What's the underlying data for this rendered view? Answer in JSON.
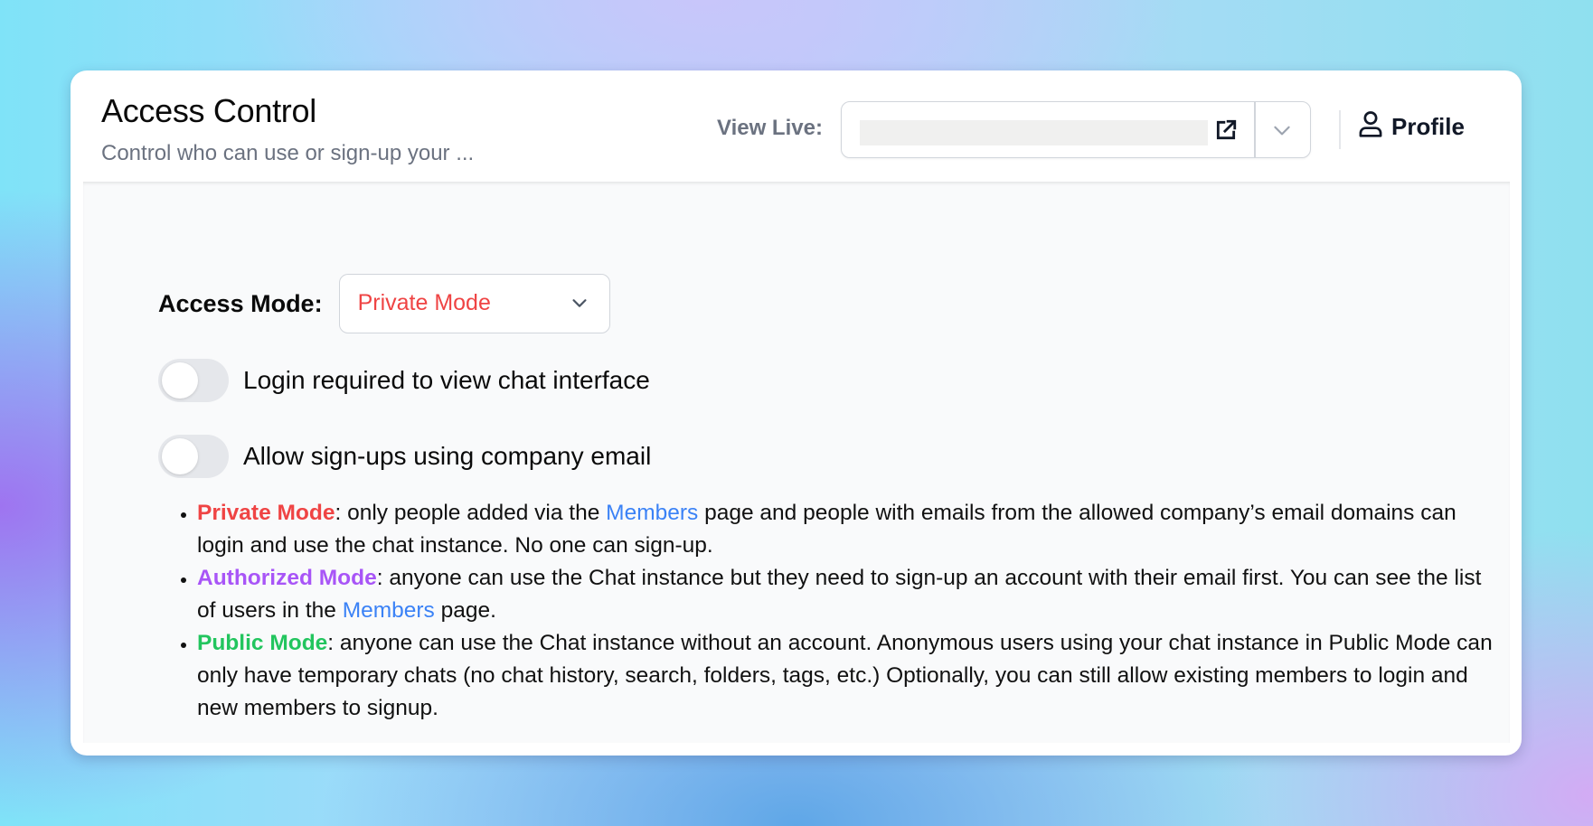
{
  "header": {
    "title": "Access Control",
    "subtitle": "Control who can use or sign-up your ...",
    "view_live_label": "View Live:",
    "view_live_url": "",
    "profile_label": "Profile"
  },
  "icons": {
    "external_link": "external-link-icon",
    "chevron_down": "chevron-down-icon",
    "user": "user-icon"
  },
  "access_mode": {
    "label": "Access Mode:",
    "selected": "Private Mode",
    "selected_color": "#ef4444"
  },
  "toggles": [
    {
      "label": "Login required to view chat interface",
      "on": false
    },
    {
      "label": "Allow sign-ups using company email",
      "on": false
    }
  ],
  "modes_info": [
    {
      "name": "Private Mode",
      "color": "#ef4444",
      "text_before_link": ": only people added via the ",
      "link": "Members",
      "text_after_link": " page and people with emails from the allowed company’s email domains can login and use the chat instance. No one can sign-up."
    },
    {
      "name": "Authorized Mode",
      "color": "#a855f7",
      "text_before_link": ": anyone can use the Chat instance but they need to sign-up an account with their email first. You can see the list of users in the ",
      "link": "Members",
      "text_after_link": " page."
    },
    {
      "name": "Public Mode",
      "color": "#22c55e",
      "text": ": anyone can use the Chat instance without an account. Anonymous users using your chat instance in Public Mode can only have temporary chats (no chat history, search, folders, tags, etc.) Optionally, you can still allow existing members to login and new members to signup."
    }
  ],
  "colors": {
    "link": "#3b82f6",
    "muted_text": "#6b7280",
    "panel_bg": "#f9fafb"
  }
}
